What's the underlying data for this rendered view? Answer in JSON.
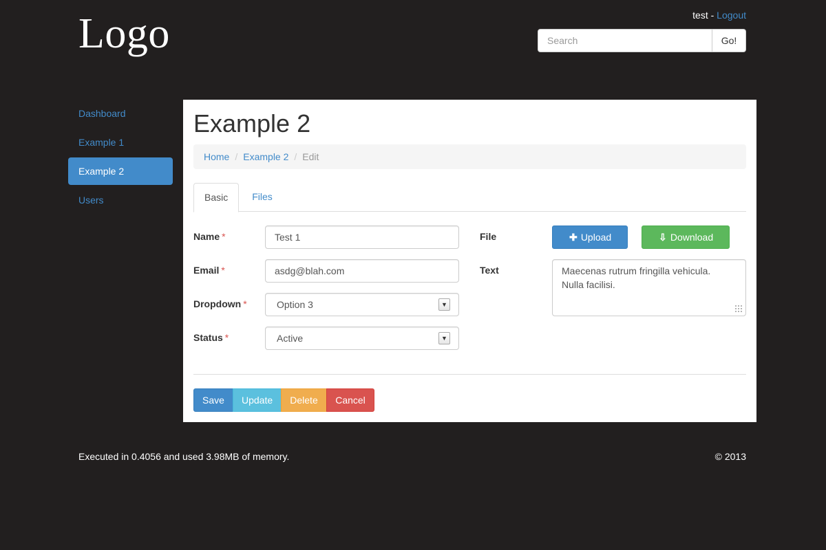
{
  "header": {
    "logo": "Logo",
    "username": "test",
    "separator": " - ",
    "logout": "Logout",
    "search_placeholder": "Search",
    "search_button": "Go!"
  },
  "sidebar": {
    "items": [
      {
        "label": "Dashboard",
        "active": false
      },
      {
        "label": "Example 1",
        "active": false
      },
      {
        "label": "Example 2",
        "active": true
      },
      {
        "label": "Users",
        "active": false
      }
    ]
  },
  "main": {
    "title": "Example 2",
    "breadcrumb": {
      "home": "Home",
      "section": "Example 2",
      "current": "Edit",
      "separator": "/"
    },
    "tabs": [
      {
        "label": "Basic",
        "active": true
      },
      {
        "label": "Files",
        "active": false
      }
    ],
    "form": {
      "required_marker": "*",
      "name_label": "Name",
      "name_value": "Test 1",
      "email_label": "Email",
      "email_value": "asdg@blah.com",
      "dropdown_label": "Dropdown",
      "dropdown_value": "Option 3",
      "status_label": "Status",
      "status_value": "Active",
      "file_label": "File",
      "upload_button": "Upload file",
      "download_button": "Download file",
      "text_label": "Text",
      "text_line1": "Maecenas rutrum fringilla vehicula.",
      "text_line2": "Nulla facilisi."
    },
    "actions": {
      "save": "Save",
      "update": "Update",
      "delete": "Delete",
      "cancel": "Cancel"
    }
  },
  "footer": {
    "stats": "Executed in 0.4056 and used 3.98MB of memory.",
    "copyright": "© 2013"
  },
  "colors": {
    "background": "#221f1f",
    "primary": "#428bca",
    "info": "#5bc0de",
    "warning": "#f0ad4e",
    "danger": "#d9534f",
    "success": "#5cb85c"
  },
  "icons": {
    "upload": "plus-icon",
    "download": "download-circle-icon",
    "select_arrow": "chevron-down-icon"
  }
}
